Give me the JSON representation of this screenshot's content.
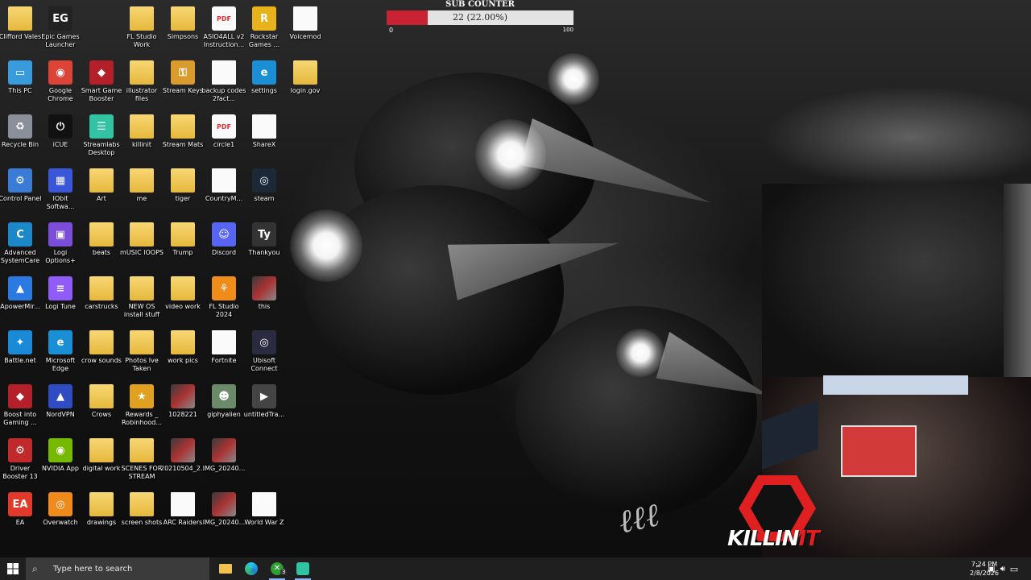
{
  "desktop_icons": [
    {
      "label": "Clifford Vales",
      "kind": "folder"
    },
    {
      "label": "Epic Games Launcher",
      "kind": "epic"
    },
    {
      "label": "FL Studio Work",
      "kind": "folder"
    },
    {
      "label": "Simpsons",
      "kind": "folder"
    },
    {
      "label": "ASIO4ALL v2 Instruction...",
      "kind": "pdf"
    },
    {
      "label": "Rockstar Games ...",
      "kind": "rockstar"
    },
    {
      "label": "Voicemod",
      "kind": "doc"
    },
    {
      "label": "This PC",
      "kind": "pc"
    },
    {
      "label": "Google Chrome",
      "kind": "chrome"
    },
    {
      "label": "Smart Game Booster",
      "kind": "booster"
    },
    {
      "label": "illustrator files",
      "kind": "folder"
    },
    {
      "label": "Stream Keys",
      "kind": "keys"
    },
    {
      "label": "backup codes 2fact...",
      "kind": "doc"
    },
    {
      "label": "settings",
      "kind": "edge"
    },
    {
      "label": "login.gov",
      "kind": "folder"
    },
    {
      "label": "Recycle Bin",
      "kind": "bin"
    },
    {
      "label": "iCUE",
      "kind": "icue"
    },
    {
      "label": "Streamlabs Desktop",
      "kind": "streamlabs"
    },
    {
      "label": "killinit",
      "kind": "folder"
    },
    {
      "label": "Stream Mats",
      "kind": "folder"
    },
    {
      "label": "circle1",
      "kind": "pdf"
    },
    {
      "label": "ShareX",
      "kind": "doc"
    },
    {
      "label": "Control Panel",
      "kind": "cpanel"
    },
    {
      "label": "IObit Softwa...",
      "kind": "iobit"
    },
    {
      "label": "Art",
      "kind": "folder"
    },
    {
      "label": "me",
      "kind": "folder"
    },
    {
      "label": "tiger",
      "kind": "folder"
    },
    {
      "label": "CountryM...",
      "kind": "doc"
    },
    {
      "label": "steam",
      "kind": "steam"
    },
    {
      "label": "Advanced SystemCare",
      "kind": "asc"
    },
    {
      "label": "Logi Options+",
      "kind": "logi"
    },
    {
      "label": "beats",
      "kind": "folder"
    },
    {
      "label": "mUSIC lOOPS",
      "kind": "folder"
    },
    {
      "label": "Trump",
      "kind": "folder"
    },
    {
      "label": "Discord",
      "kind": "discord"
    },
    {
      "label": "Thankyou",
      "kind": "thankyou"
    },
    {
      "label": "ApowerMir...",
      "kind": "apower"
    },
    {
      "label": "Logi Tune",
      "kind": "logitune"
    },
    {
      "label": "carstrucks",
      "kind": "folder"
    },
    {
      "label": "NEW OS install stuff",
      "kind": "folder"
    },
    {
      "label": "video work",
      "kind": "folder"
    },
    {
      "label": "FL Studio 2024",
      "kind": "flstudio"
    },
    {
      "label": "this",
      "kind": "image"
    },
    {
      "label": "Battle.net",
      "kind": "battlenet"
    },
    {
      "label": "Microsoft Edge",
      "kind": "edge"
    },
    {
      "label": "crow sounds",
      "kind": "folder"
    },
    {
      "label": "Photos Ive Taken",
      "kind": "folder"
    },
    {
      "label": "work pics",
      "kind": "folder"
    },
    {
      "label": "Fortnite",
      "kind": "doc"
    },
    {
      "label": "Ubisoft Connect",
      "kind": "ubisoft"
    },
    {
      "label": "Boost into Gaming ...",
      "kind": "booster"
    },
    {
      "label": "NordVPN",
      "kind": "nordvpn"
    },
    {
      "label": "Crows",
      "kind": "folder"
    },
    {
      "label": "Rewards _ Robinhood...",
      "kind": "star"
    },
    {
      "label": "1028221",
      "kind": "image"
    },
    {
      "label": "giphyalien",
      "kind": "alien"
    },
    {
      "label": "untitledTra...",
      "kind": "video"
    },
    {
      "label": "Driver Booster 13",
      "kind": "driverbooster"
    },
    {
      "label": "NVIDIA App",
      "kind": "nvidia"
    },
    {
      "label": "digital work",
      "kind": "folder"
    },
    {
      "label": "SCENES FOR STREAM",
      "kind": "folder"
    },
    {
      "label": "20210504_2...",
      "kind": "image"
    },
    {
      "label": "IMG_20240...",
      "kind": "image"
    },
    {
      "label": "EA",
      "kind": "ea"
    },
    {
      "label": "Overwatch",
      "kind": "overwatch"
    },
    {
      "label": "drawings",
      "kind": "folder"
    },
    {
      "label": "screen shots",
      "kind": "folder"
    },
    {
      "label": "ARC Raiders",
      "kind": "doc"
    },
    {
      "label": "IMG_20240...",
      "kind": "image"
    },
    {
      "label": "World War Z",
      "kind": "doc"
    }
  ],
  "sub_counter": {
    "title": "SUB COUNTER",
    "value_text": "22 (22.00%)",
    "progress_fraction": 0.22,
    "min": "0",
    "max": "100",
    "fill_color": "#c82233"
  },
  "overlay": {
    "logo_text_white": "KILLIN",
    "logo_text_red": "IT",
    "accent_color": "#e02020"
  },
  "taskbar": {
    "search_placeholder": "Type here to search",
    "apps": [
      {
        "name": "file-explorer-icon",
        "badge": ""
      },
      {
        "name": "edge-icon",
        "badge": ""
      },
      {
        "name": "xbox-icon",
        "badge": "3"
      },
      {
        "name": "streamlabs-icon",
        "badge": ""
      }
    ],
    "time": "7:24 PM",
    "date": "2/8/2026"
  }
}
